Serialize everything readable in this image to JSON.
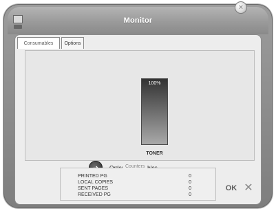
{
  "window": {
    "title": "Monitor"
  },
  "tabs": [
    {
      "label": "Consumables",
      "active": true
    },
    {
      "label": "Options",
      "active": false
    }
  ],
  "consumables": {
    "toner": {
      "label": "TONER",
      "percent": 100,
      "percent_text": "100%"
    },
    "order_link": "Order consumables"
  },
  "counters": {
    "title": "Counters",
    "rows": [
      {
        "name": "PRINTED PG",
        "value": "0"
      },
      {
        "name": "LOCAL COPIES",
        "value": "0"
      },
      {
        "name": "SENT PAGES",
        "value": "0"
      },
      {
        "name": "RECEIVED PG",
        "value": "0"
      }
    ]
  },
  "buttons": {
    "ok": "OK",
    "cancel": "✕"
  },
  "icons": {
    "app": "monitor-icon",
    "close": "close-icon",
    "order": "cursor-arrow-icon"
  }
}
